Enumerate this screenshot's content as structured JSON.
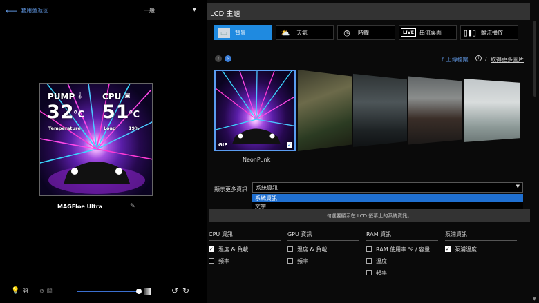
{
  "left": {
    "back_label": "套用並返回",
    "mode_select": "一般",
    "preview": {
      "pump_label": "PUMP",
      "pump_value": "32",
      "pump_unit": "°C",
      "pump_sub": "Temperature",
      "cpu_label": "CPU",
      "cpu_value": "51",
      "cpu_unit": "°C",
      "cpu_sub": "Load",
      "cpu_pct": "19%"
    },
    "device_name": "MAGFloe Ultra",
    "light_on_label": "開",
    "light_off_label": "關",
    "brightness": 0.9
  },
  "right": {
    "title": "LCD 主題",
    "tabs": [
      {
        "label": "背景",
        "icon": "image-icon",
        "active": true
      },
      {
        "label": "天氣",
        "icon": "weather-icon",
        "active": false
      },
      {
        "label": "時鐘",
        "icon": "clock-icon",
        "active": false
      },
      {
        "label": "串流桌面",
        "icon": "live-icon",
        "active": false
      },
      {
        "label": "輪流播放",
        "icon": "carousel-icon",
        "active": false
      }
    ],
    "tab_live_badge": "LIVE",
    "upload_label": "上傳檔案",
    "more_link": "取得更多圖片",
    "selected_thumb": {
      "badge": "GIF",
      "name": "NeonPunk"
    },
    "more_info_label": "顯示更多資訊",
    "info_select_value": "系統資訊",
    "info_options": [
      {
        "label": "系統資訊",
        "selected": true
      },
      {
        "label": "文字",
        "selected": false
      }
    ],
    "hint": "勾選要顯示在 LCD 螢幕上的系統資訊。",
    "groups": [
      {
        "title": "CPU 資訊",
        "items": [
          {
            "label": "溫度 & 負載",
            "checked": true
          },
          {
            "label": "頻率",
            "checked": false
          }
        ]
      },
      {
        "title": "GPU 資訊",
        "items": [
          {
            "label": "溫度 & 負載",
            "checked": false
          },
          {
            "label": "頻率",
            "checked": false
          }
        ]
      },
      {
        "title": "RAM 資訊",
        "items": [
          {
            "label": "RAM 使用率 % / 容量",
            "checked": false
          },
          {
            "label": "溫度",
            "checked": false
          },
          {
            "label": "頻率",
            "checked": false
          }
        ]
      },
      {
        "title": "泵浦資訊",
        "items": [
          {
            "label": "泵浦溫度",
            "checked": true
          }
        ]
      }
    ]
  }
}
